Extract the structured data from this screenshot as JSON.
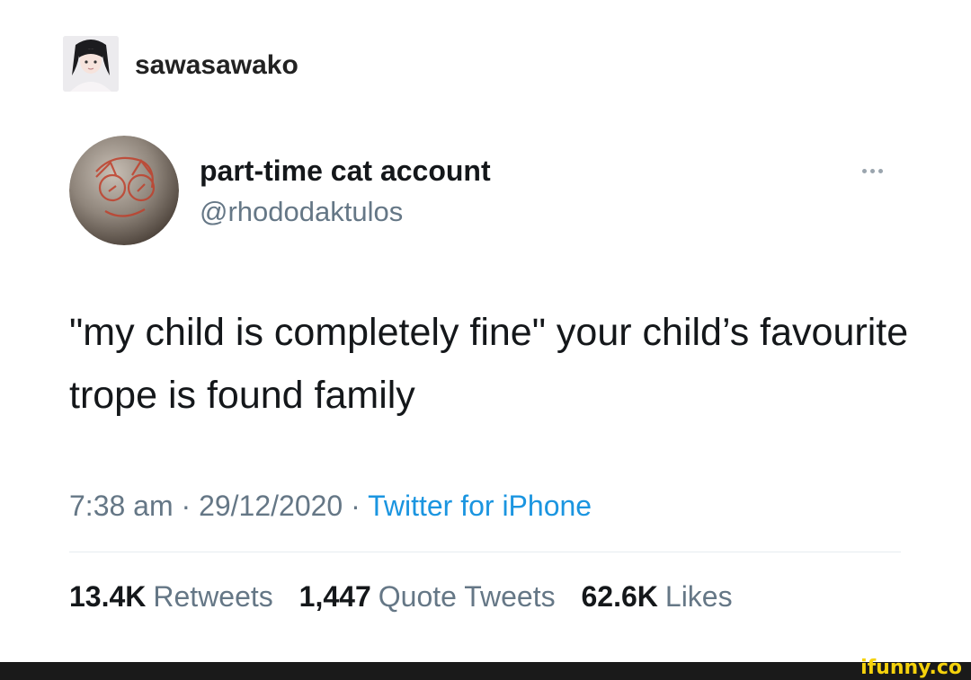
{
  "tumblr_post": {
    "username": "sawasawako"
  },
  "tweet": {
    "display_name": "part-time cat account",
    "handle": "@rhododaktulos",
    "more_icon": "ellipsis-icon",
    "text": "\"my child is completely fine\" your child’s favourite trope is found family",
    "time": "7:38 am",
    "separator": "·",
    "date": "29/12/2020",
    "source": "Twitter for iPhone",
    "stats": {
      "retweets_count": "13.4K",
      "retweets_label": "Retweets",
      "quotes_count": "1,447",
      "quotes_label": "Quote Tweets",
      "likes_count": "62.6K",
      "likes_label": "Likes"
    }
  },
  "watermark": {
    "text": "ifunny.co"
  },
  "colors": {
    "text": "#14171a",
    "secondary": "#657786",
    "link": "#1b95e0",
    "watermark": "#f5d20c"
  }
}
